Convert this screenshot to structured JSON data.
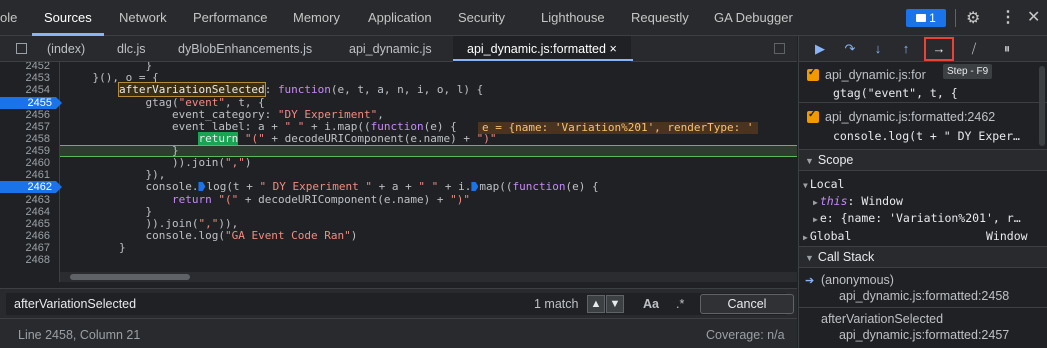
{
  "top_tabs": [
    {
      "label": "ole"
    },
    {
      "label": "Sources"
    },
    {
      "label": "Network"
    },
    {
      "label": "Performance"
    },
    {
      "label": "Memory"
    },
    {
      "label": "Application"
    },
    {
      "label": "Security"
    },
    {
      "label": "Lighthouse"
    },
    {
      "label": "Requestly"
    },
    {
      "label": "GA Debugger"
    }
  ],
  "messages_count": "1",
  "file_tabs": [
    {
      "label": "(index)"
    },
    {
      "label": "dlc.js"
    },
    {
      "label": "dyBlobEnhancements.js"
    },
    {
      "label": "api_dynamic.js"
    },
    {
      "label": "api_dynamic.js:formatted"
    }
  ],
  "close_tab_glyph": "×",
  "code": {
    "line_numbers": [
      "2452",
      "2453",
      "2454",
      "2455",
      "2456",
      "2457",
      "2458",
      "2459",
      "2460",
      "2461",
      "2462",
      "2463",
      "2464",
      "2465",
      "2466",
      "2467",
      "2468"
    ],
    "breakpoint_lines": [
      "2455",
      "2462"
    ],
    "inline_value": "e = {name: 'Variation%201', renderType: '"
  },
  "search": {
    "value": "afterVariationSelected",
    "match_count": "1 match",
    "case_label": "Aa",
    "regex_label": ".*",
    "cancel_label": "Cancel"
  },
  "status": {
    "position": "Line 2458, Column 21",
    "coverage": "Coverage: n/a"
  },
  "debugger": {
    "tooltip": "Step - F9",
    "breakpoints": [
      {
        "location": "api_dynamic.js:formatted:2455",
        "location_visible": "api_dynamic.js:for",
        "suffix": "455",
        "code": "gtag(\"event\", t, {"
      },
      {
        "location": "api_dynamic.js:formatted:2462",
        "code": "console.log(t + \" DY Exper…"
      }
    ],
    "scope_title": "Scope",
    "scope": {
      "local": "Local",
      "this_key": "this",
      "this_value": "Window",
      "e_line": "e: {name: 'Variation%201', r…",
      "global": "Global",
      "global_value": "Window"
    },
    "callstack_title": "Call Stack",
    "callstack": [
      {
        "fn": "(anonymous)",
        "loc": "api_dynamic.js:formatted:2458"
      },
      {
        "fn": "afterVariationSelected",
        "loc": "api_dynamic.js:formatted:2457"
      }
    ]
  },
  "colors": {
    "accent": "#8ab4f8",
    "breakpoint": "#1a73e8",
    "highlight_outline": "#ea4335",
    "checkbox": "#f29900"
  }
}
